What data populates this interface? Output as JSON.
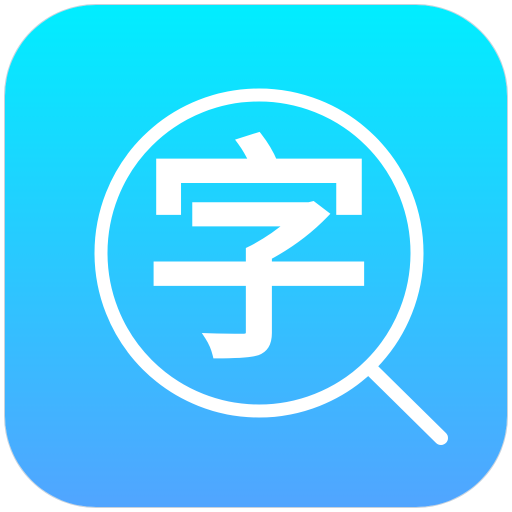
{
  "app_icon": {
    "glyph": "字",
    "icon_name": "magnifier-search-icon",
    "colors": {
      "gradient_top": "#00EEFF",
      "gradient_bottom": "#52A4FF",
      "foreground": "#FFFFFF",
      "tile_border": "#C8D2DC"
    }
  }
}
